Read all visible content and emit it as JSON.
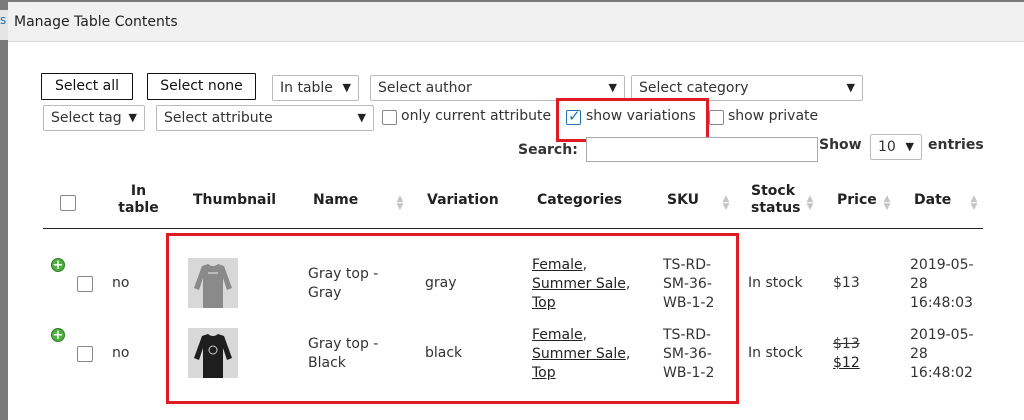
{
  "dialog": {
    "title": "Manage Table Contents",
    "left_fragment": "s"
  },
  "toolbar": {
    "select_all": "Select all",
    "select_none": "Select none",
    "in_table_filter": "In table",
    "author_filter": "Select author",
    "category_filter": "Select category",
    "tag_filter": "Select tag",
    "attribute_filter": "Select attribute",
    "only_current_attribute": "only current attribute",
    "show_variations": "show variations",
    "show_private": "show private",
    "search_label": "Search:",
    "search_value": "",
    "show_label": "Show",
    "entries_value": "10",
    "entries_label": "entries"
  },
  "table": {
    "headers": {
      "in_table": "In table",
      "thumbnail": "Thumbnail",
      "name": "Name",
      "variation": "Variation",
      "categories": "Categories",
      "sku": "SKU",
      "stock_status": "Stock status",
      "price": "Price",
      "date": "Date"
    },
    "rows": [
      {
        "in_table": "no",
        "name_l1": "Gray top -",
        "name_l2": "Gray",
        "variation": "gray",
        "cat1": "Female",
        "cat2": "Summer Sale",
        "cat3": "Top",
        "sku_l1": "TS-RD-",
        "sku_l2": "SM-36-",
        "sku_l3": "WB-1-2",
        "stock": "In stock",
        "price": "$13",
        "date_l1": "2019-05-",
        "date_l2": "28",
        "date_l3": "16:48:03",
        "thumb_color": "#8a8a8a"
      },
      {
        "in_table": "no",
        "name_l1": "Gray top -",
        "name_l2": "Black",
        "variation": "black",
        "cat1": "Female",
        "cat2": "Summer Sale",
        "cat3": "Top",
        "sku_l1": "TS-RD-",
        "sku_l2": "SM-36-",
        "sku_l3": "WB-1-2",
        "stock": "In stock",
        "price_old": "$13",
        "price_new": "$12",
        "date_l1": "2019-05-",
        "date_l2": "28",
        "date_l3": "16:48:02",
        "thumb_color": "#1e1e1e"
      }
    ]
  },
  "colors": {
    "highlight": "#e01b24",
    "plus": "#4caf3f",
    "check": "#2271b1"
  }
}
